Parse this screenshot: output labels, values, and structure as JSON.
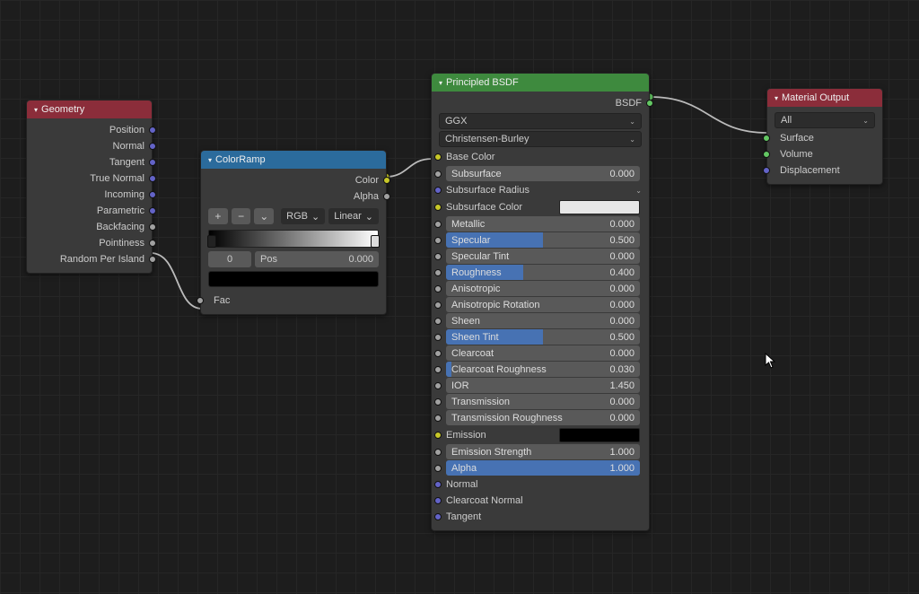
{
  "geometry": {
    "title": "Geometry",
    "outputs": [
      "Position",
      "Normal",
      "Tangent",
      "True Normal",
      "Incoming",
      "Parametric",
      "Backfacing",
      "Pointiness",
      "Random Per Island"
    ]
  },
  "colorramp": {
    "title": "ColorRamp",
    "out_color": "Color",
    "out_alpha": "Alpha",
    "btn_add": "+",
    "btn_sub": "−",
    "btn_menu": "⌄",
    "mode_rgb": "RGB",
    "mode_interp": "Linear",
    "index": "0",
    "pos_label": "Pos",
    "pos_value": "0.000",
    "fac": "Fac"
  },
  "bsdf": {
    "title": "Principled BSDF",
    "out": "BSDF",
    "dist": "GGX",
    "sss_method": "Christensen-Burley",
    "base_color": "Base Color",
    "subsurface": {
      "label": "Subsurface",
      "value": "0.000",
      "fill": 0
    },
    "sss_radius": "Subsurface Radius",
    "sss_color": "Subsurface Color",
    "sss_color_hex": "#e6e6e6",
    "metallic": {
      "label": "Metallic",
      "value": "0.000",
      "fill": 0
    },
    "specular": {
      "label": "Specular",
      "value": "0.500",
      "fill": 50
    },
    "specular_tint": {
      "label": "Specular Tint",
      "value": "0.000",
      "fill": 0
    },
    "roughness": {
      "label": "Roughness",
      "value": "0.400",
      "fill": 40
    },
    "anisotropic": {
      "label": "Anisotropic",
      "value": "0.000",
      "fill": 0
    },
    "aniso_rot": {
      "label": "Anisotropic Rotation",
      "value": "0.000",
      "fill": 0
    },
    "sheen": {
      "label": "Sheen",
      "value": "0.000",
      "fill": 0
    },
    "sheen_tint": {
      "label": "Sheen Tint",
      "value": "0.500",
      "fill": 50
    },
    "clearcoat": {
      "label": "Clearcoat",
      "value": "0.000",
      "fill": 0
    },
    "cc_rough": {
      "label": "Clearcoat Roughness",
      "value": "0.030",
      "fill": 3
    },
    "ior": {
      "label": "IOR",
      "value": "1.450",
      "fill": 0
    },
    "transmission": {
      "label": "Transmission",
      "value": "0.000",
      "fill": 0
    },
    "trans_rough": {
      "label": "Transmission Roughness",
      "value": "0.000",
      "fill": 0
    },
    "emission": "Emission",
    "emission_hex": "#000000",
    "emission_str": {
      "label": "Emission Strength",
      "value": "1.000",
      "fill": 0
    },
    "alpha": {
      "label": "Alpha",
      "value": "1.000",
      "fill": 100
    },
    "normal": "Normal",
    "cc_normal": "Clearcoat Normal",
    "tangent": "Tangent"
  },
  "output": {
    "title": "Material Output",
    "target": "All",
    "surface": "Surface",
    "volume": "Volume",
    "displacement": "Displacement"
  },
  "cursor": "⬉"
}
